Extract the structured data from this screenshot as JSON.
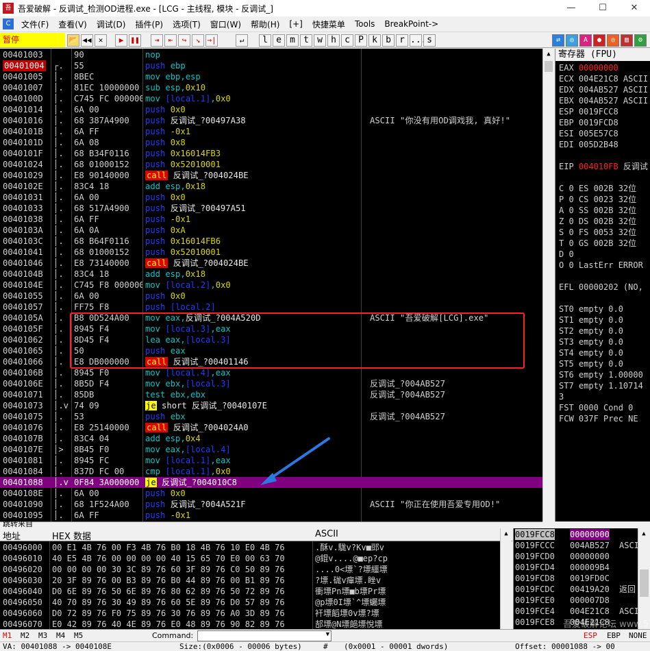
{
  "window": {
    "title": "吾爱破解 - 反调试_检测OD进程.exe - [LCG - 主线程, 模块 - 反调试_]",
    "app_icon": "吾",
    "min": "—",
    "max": "☐",
    "close": "✕"
  },
  "menu": {
    "icon": "C",
    "items": [
      "文件(F)",
      "查看(V)",
      "调试(D)",
      "插件(P)",
      "选项(T)",
      "窗口(W)",
      "帮助(H)",
      "[+]",
      "快捷菜单",
      "Tools",
      "BreakPoint->"
    ]
  },
  "toolbar": {
    "status": "暂停",
    "buttons": [
      "📂",
      "◀◀",
      "✕",
      "▶",
      "❚❚",
      "⇥",
      "⇤",
      "↪",
      "↘",
      "→|",
      "↵"
    ],
    "letters": [
      "l",
      "e",
      "m",
      "t",
      "w",
      "h",
      "c",
      "P",
      "k",
      "b",
      "r",
      "...",
      "s"
    ],
    "right_buttons": [
      "⇄",
      "◎",
      "A",
      "●",
      "◎",
      "▤",
      "⚙",
      "Ω",
      "◑"
    ],
    "colors": {
      "accent_red": "#e00000",
      "pause_bg": "#ffff00"
    }
  },
  "disasm": {
    "rows": [
      {
        "addr": "00401003",
        "mark": "",
        "hex": "90",
        "dis": [
          [
            "op",
            "nop"
          ]
        ],
        "cmt": ""
      },
      {
        "addr": "00401004",
        "mark": "┌.",
        "hex": "55",
        "dis": [
          [
            "push",
            "push "
          ],
          [
            "op",
            "ebp"
          ]
        ],
        "cmt": "",
        "eip": true
      },
      {
        "addr": "00401005",
        "mark": "│.",
        "hex": "8BEC",
        "dis": [
          [
            "op",
            "mov ebp,esp"
          ]
        ],
        "cmt": ""
      },
      {
        "addr": "00401007",
        "mark": "│.",
        "hex": "81EC 10000000",
        "dis": [
          [
            "op",
            "sub esp,"
          ],
          [
            "num",
            "0x10"
          ]
        ],
        "cmt": ""
      },
      {
        "addr": "0040100D",
        "mark": "│.",
        "hex": "C745 FC 00000000",
        "dis": [
          [
            "op",
            "mov "
          ],
          [
            "blue",
            "[local.1]"
          ],
          [
            "op",
            ","
          ],
          [
            "num",
            "0x0"
          ]
        ],
        "cmt": ""
      },
      {
        "addr": "00401014",
        "mark": "│.",
        "hex": "6A 00",
        "dis": [
          [
            "push",
            "push "
          ],
          [
            "num",
            "0x0"
          ]
        ],
        "cmt": ""
      },
      {
        "addr": "00401016",
        "mark": "│.",
        "hex": "68 387A4900",
        "dis": [
          [
            "push",
            "push "
          ],
          [
            "txt",
            "反调试_?00497A38"
          ]
        ],
        "cmt": "ASCII \"你没有用OD调戏我, 真好!\""
      },
      {
        "addr": "0040101B",
        "mark": "│.",
        "hex": "6A FF",
        "dis": [
          [
            "push",
            "push "
          ],
          [
            "num",
            "-0x1"
          ]
        ],
        "cmt": ""
      },
      {
        "addr": "0040101D",
        "mark": "│.",
        "hex": "6A 08",
        "dis": [
          [
            "push",
            "push "
          ],
          [
            "num",
            "0x8"
          ]
        ],
        "cmt": ""
      },
      {
        "addr": "0040101F",
        "mark": "│.",
        "hex": "68 B34F0116",
        "dis": [
          [
            "push",
            "push "
          ],
          [
            "num",
            "0x16014FB3"
          ]
        ],
        "cmt": ""
      },
      {
        "addr": "00401024",
        "mark": "│.",
        "hex": "68 01000152",
        "dis": [
          [
            "push",
            "push "
          ],
          [
            "num",
            "0x52010001"
          ]
        ],
        "cmt": ""
      },
      {
        "addr": "00401029",
        "mark": "│.",
        "hex": "E8 90140000",
        "dis": [
          [
            "call",
            "call"
          ],
          [
            "txt",
            " 反调试_?004024BE"
          ]
        ],
        "cmt": ""
      },
      {
        "addr": "0040102E",
        "mark": "│.",
        "hex": "83C4 18",
        "dis": [
          [
            "op",
            "add esp,"
          ],
          [
            "num",
            "0x18"
          ]
        ],
        "cmt": ""
      },
      {
        "addr": "00401031",
        "mark": "│.",
        "hex": "6A 00",
        "dis": [
          [
            "push",
            "push "
          ],
          [
            "num",
            "0x0"
          ]
        ],
        "cmt": ""
      },
      {
        "addr": "00401033",
        "mark": "│.",
        "hex": "68 517A4900",
        "dis": [
          [
            "push",
            "push "
          ],
          [
            "txt",
            "反调试_?00497A51"
          ]
        ],
        "cmt": ""
      },
      {
        "addr": "00401038",
        "mark": "│.",
        "hex": "6A FF",
        "dis": [
          [
            "push",
            "push "
          ],
          [
            "num",
            "-0x1"
          ]
        ],
        "cmt": ""
      },
      {
        "addr": "0040103A",
        "mark": "│.",
        "hex": "6A 0A",
        "dis": [
          [
            "push",
            "push "
          ],
          [
            "num",
            "0xA"
          ]
        ],
        "cmt": ""
      },
      {
        "addr": "0040103C",
        "mark": "│.",
        "hex": "68 B64F0116",
        "dis": [
          [
            "push",
            "push "
          ],
          [
            "num",
            "0x16014FB6"
          ]
        ],
        "cmt": ""
      },
      {
        "addr": "00401041",
        "mark": "│.",
        "hex": "68 01000152",
        "dis": [
          [
            "push",
            "push "
          ],
          [
            "num",
            "0x52010001"
          ]
        ],
        "cmt": ""
      },
      {
        "addr": "00401046",
        "mark": "│.",
        "hex": "E8 73140000",
        "dis": [
          [
            "call",
            "call"
          ],
          [
            "txt",
            " 反调试_?004024BE"
          ]
        ],
        "cmt": ""
      },
      {
        "addr": "0040104B",
        "mark": "│.",
        "hex": "83C4 18",
        "dis": [
          [
            "op",
            "add esp,"
          ],
          [
            "num",
            "0x18"
          ]
        ],
        "cmt": ""
      },
      {
        "addr": "0040104E",
        "mark": "│.",
        "hex": "C745 F8 00000000",
        "dis": [
          [
            "op",
            "mov "
          ],
          [
            "blue",
            "[local.2]"
          ],
          [
            "op",
            ","
          ],
          [
            "num",
            "0x0"
          ]
        ],
        "cmt": ""
      },
      {
        "addr": "00401055",
        "mark": "│.",
        "hex": "6A 00",
        "dis": [
          [
            "push",
            "push "
          ],
          [
            "num",
            "0x0"
          ]
        ],
        "cmt": ""
      },
      {
        "addr": "00401057",
        "mark": "│.",
        "hex": "FF75 F8",
        "dis": [
          [
            "push",
            "push "
          ],
          [
            "blue",
            "[local.2]"
          ]
        ],
        "cmt": ""
      },
      {
        "addr": "0040105A",
        "mark": "│.",
        "hex": "B8 0D524A00",
        "dis": [
          [
            "op",
            "mov eax,"
          ],
          [
            "txt",
            "反调试_?004A520D"
          ]
        ],
        "cmt": "ASCII \"吾爱破解[LCG].exe\""
      },
      {
        "addr": "0040105F",
        "mark": "│.",
        "hex": "8945 F4",
        "dis": [
          [
            "op",
            "mov "
          ],
          [
            "blue",
            "[local.3]"
          ],
          [
            "op",
            ",eax"
          ]
        ],
        "cmt": ""
      },
      {
        "addr": "00401062",
        "mark": "│.",
        "hex": "8D45 F4",
        "dis": [
          [
            "op",
            "lea eax,"
          ],
          [
            "blue",
            "[local.3]"
          ]
        ],
        "cmt": ""
      },
      {
        "addr": "00401065",
        "mark": "│.",
        "hex": "50",
        "dis": [
          [
            "push",
            "push "
          ],
          [
            "op",
            "eax"
          ]
        ],
        "cmt": ""
      },
      {
        "addr": "00401066",
        "mark": "│.",
        "hex": "E8 DB000000",
        "dis": [
          [
            "call",
            "call"
          ],
          [
            "txt",
            " 反调试_?00401146"
          ]
        ],
        "cmt": ""
      },
      {
        "addr": "0040106B",
        "mark": "│.",
        "hex": "8945 F0",
        "dis": [
          [
            "op",
            "mov "
          ],
          [
            "blue",
            "[local.4]"
          ],
          [
            "op",
            ",eax"
          ]
        ],
        "cmt": ""
      },
      {
        "addr": "0040106E",
        "mark": "│.",
        "hex": "8B5D F4",
        "dis": [
          [
            "op",
            "mov ebx,"
          ],
          [
            "blue",
            "[local.3]"
          ]
        ],
        "cmt": "反调试_?004AB527"
      },
      {
        "addr": "00401071",
        "mark": "│.",
        "hex": "85DB",
        "dis": [
          [
            "op",
            "test ebx,ebx"
          ]
        ],
        "cmt": "反调试_?004AB527"
      },
      {
        "addr": "00401073",
        "mark": "│.v",
        "hex": "74 09",
        "dis": [
          [
            "je",
            "je"
          ],
          [
            "txt",
            " short 反调试_?0040107E"
          ]
        ],
        "cmt": ""
      },
      {
        "addr": "00401075",
        "mark": "│.",
        "hex": "53",
        "dis": [
          [
            "push",
            "push "
          ],
          [
            "op",
            "ebx"
          ]
        ],
        "cmt": "反调试_?004AB527"
      },
      {
        "addr": "00401076",
        "mark": "│.",
        "hex": "E8 25140000",
        "dis": [
          [
            "call",
            "call"
          ],
          [
            "txt",
            " 反调试_?004024A0"
          ]
        ],
        "cmt": ""
      },
      {
        "addr": "0040107B",
        "mark": "│.",
        "hex": "83C4 04",
        "dis": [
          [
            "op",
            "add esp,"
          ],
          [
            "num",
            "0x4"
          ]
        ],
        "cmt": ""
      },
      {
        "addr": "0040107E",
        "mark": "│>",
        "hex": "8B45 F0",
        "dis": [
          [
            "op",
            "mov eax,"
          ],
          [
            "blue",
            "[local.4]"
          ]
        ],
        "cmt": ""
      },
      {
        "addr": "00401081",
        "mark": "│.",
        "hex": "8945 FC",
        "dis": [
          [
            "op",
            "mov "
          ],
          [
            "blue",
            "[local.1]"
          ],
          [
            "op",
            ",eax"
          ]
        ],
        "cmt": ""
      },
      {
        "addr": "00401084",
        "mark": "│.",
        "hex": "837D FC 00",
        "dis": [
          [
            "op",
            "cmp "
          ],
          [
            "blue",
            "[local.1]"
          ],
          [
            "op",
            ","
          ],
          [
            "num",
            "0x0"
          ]
        ],
        "cmt": ""
      },
      {
        "addr": "00401088",
        "mark": "│.v",
        "hex": "0F84 3A000000",
        "dis": [
          [
            "je",
            "je"
          ],
          [
            "txt",
            " 反调试_?004010C8"
          ]
        ],
        "cmt": "",
        "hl": true
      },
      {
        "addr": "0040108E",
        "mark": "│.",
        "hex": "6A 00",
        "dis": [
          [
            "push",
            "push "
          ],
          [
            "num",
            "0x0"
          ]
        ],
        "cmt": ""
      },
      {
        "addr": "00401090",
        "mark": "│.",
        "hex": "68 1F524A00",
        "dis": [
          [
            "push",
            "push "
          ],
          [
            "txt",
            "反调试_?004A521F"
          ]
        ],
        "cmt": "ASCII \"你正在使用吾爱专用OD!\""
      },
      {
        "addr": "00401095",
        "mark": "│.",
        "hex": "6A FF",
        "dis": [
          [
            "push",
            "push "
          ],
          [
            "num",
            "-0x1"
          ]
        ],
        "cmt": ""
      }
    ],
    "info": "跳转来自"
  },
  "registers": {
    "title": "寄存器 (FPU)",
    "lines": [
      {
        "t": "EAX ",
        "v": "00000000",
        "red": true,
        "s": ""
      },
      {
        "t": "ECX ",
        "v": "004E21C8",
        "s": " ASCII"
      },
      {
        "t": "EDX ",
        "v": "004AB527",
        "s": " ASCII"
      },
      {
        "t": "EBX ",
        "v": "004AB527",
        "s": " ASCII"
      },
      {
        "t": "ESP ",
        "v": "0019FCC8",
        "s": ""
      },
      {
        "t": "EBP ",
        "v": "0019FCD8",
        "s": ""
      },
      {
        "t": "ESI ",
        "v": "005E57C8",
        "s": ""
      },
      {
        "t": "EDI ",
        "v": "005D2B48",
        "s": ""
      },
      {
        "t": "",
        "v": "",
        "s": ""
      },
      {
        "t": "EIP ",
        "v": "004010FB",
        "red": true,
        "s": " 反调试"
      },
      {
        "t": "",
        "v": "",
        "s": ""
      },
      {
        "t": "C 0  ES 002B 32位",
        "v": "",
        "s": ""
      },
      {
        "t": "P 0  CS 0023 32位",
        "v": "",
        "s": ""
      },
      {
        "t": "A 0  SS 002B 32位",
        "v": "",
        "s": ""
      },
      {
        "t": "Z 0  DS 002B 32位",
        "v": "",
        "s": ""
      },
      {
        "t": "S 0  FS 0053 32位",
        "v": "",
        "s": ""
      },
      {
        "t": "T 0  GS 002B 32位",
        "v": "",
        "s": ""
      },
      {
        "t": "D 0",
        "v": "",
        "s": ""
      },
      {
        "t": "O 0  LastErr ERROR",
        "v": "",
        "s": ""
      },
      {
        "t": "",
        "v": "",
        "s": ""
      },
      {
        "t": "EFL 00000202 (NO,",
        "v": "",
        "s": ""
      },
      {
        "t": "",
        "v": "",
        "s": ""
      },
      {
        "t": "ST0 empty 0.0",
        "v": "",
        "s": ""
      },
      {
        "t": "ST1 empty 0.0",
        "v": "",
        "s": ""
      },
      {
        "t": "ST2 empty 0.0",
        "v": "",
        "s": ""
      },
      {
        "t": "ST3 empty 0.0",
        "v": "",
        "s": ""
      },
      {
        "t": "ST4 empty 0.0",
        "v": "",
        "s": ""
      },
      {
        "t": "ST5 empty 0.0",
        "v": "",
        "s": ""
      },
      {
        "t": "ST6 empty 1.00000",
        "v": "",
        "s": ""
      },
      {
        "t": "ST7 empty 1.10714",
        "v": "",
        "s": ""
      },
      {
        "t": "                 3",
        "v": "",
        "s": ""
      },
      {
        "t": "FST 0000  Cond 0",
        "v": "",
        "s": ""
      },
      {
        "t": "FCW 037F  Prec NE",
        "v": "",
        "s": ""
      }
    ]
  },
  "dump": {
    "headers": {
      "addr": "地址",
      "hex": "HEX 数据",
      "ascii": "ASCII"
    },
    "rows": [
      {
        "a": "00496000",
        "h": "00 E1 4B 76 00 F3 4B 76 B0 18 4B 76 10 E0 4B 76",
        "s": ".酥v.駹v?Kv■郖v"
      },
      {
        "a": "00496010",
        "h": "40 E5 4B 76 00 00 00 00 40 15 65 70 E0 00 63 70",
        "s": "@錕v....@■ep?cp"
      },
      {
        "a": "00496020",
        "h": "00 00 00 00 30 3C 89 76 60 3F 89 76 C0 50 89 76",
        "s": "....0<墂`?墂繮墂"
      },
      {
        "a": "00496030",
        "h": "20 3F 89 76 00 B3 89 76 B0 44 89 76 00 B1 89 76",
        "s": " ?墂.硥v癉墂.睉v"
      },
      {
        "a": "00496040",
        "h": "D0 6E 89 76 50 6E 89 76 80 62 89 76 50 72 89 76",
        "s": "衝墂Pn墂■b墂Pr墂"
      },
      {
        "a": "00496050",
        "h": "40 70 89 76 30 49 89 76 60 5E 89 76 D0 57 89 76",
        "s": "@p墂0I墂`^墂蠾墂"
      },
      {
        "a": "00496060",
        "h": "D0 72 89 76 F0 75 89 76 30 76 89 76 A0 3D 89 76",
        "s": "衦墂饀墂0v墂?墂"
      },
      {
        "a": "00496070",
        "h": "E0 42 89 76 40 4E 89 76 E0 48 89 76 90 82 89 76",
        "s": "郆墂@N墂郒墂悅墂"
      }
    ]
  },
  "stack": {
    "rows": [
      {
        "a": "0019FCC8",
        "v": "00000000",
        "s": "",
        "sel": true
      },
      {
        "a": "0019FCCC",
        "v": "004AB527",
        "s": "ASCII"
      },
      {
        "a": "0019FCD0",
        "v": "00000000",
        "s": ""
      },
      {
        "a": "0019FCD4",
        "v": "000009B4",
        "s": ""
      },
      {
        "a": "0019FCD8",
        "v": "0019FD0C",
        "s": ""
      },
      {
        "a": "0019FCDC",
        "v": "00419A20",
        "s": "返回"
      },
      {
        "a": "0019FCE0",
        "v": "000007D8",
        "s": ""
      },
      {
        "a": "0019FCE4",
        "v": "004E21C8",
        "s": "ASCII"
      },
      {
        "a": "0019FCE8",
        "v": "004E21C8",
        "s": ""
      }
    ]
  },
  "cmdbar": {
    "tabs": [
      "M1",
      "M2",
      "M3",
      "M4",
      "M5"
    ],
    "label": "Command:",
    "btns": [
      "ESP",
      "EBP",
      "NONE"
    ]
  },
  "statusbar": {
    "va": "VA: 00401088 -> 0040108E",
    "size": "Size:(0x0006 - 00006 bytes)",
    "hash": "#",
    "dw": "(0x0001 - 00001 dwords)",
    "offset": "Offset: 00001088 -> 00"
  },
  "watermark": "吾爱破解论坛 www.52pojie.cn"
}
